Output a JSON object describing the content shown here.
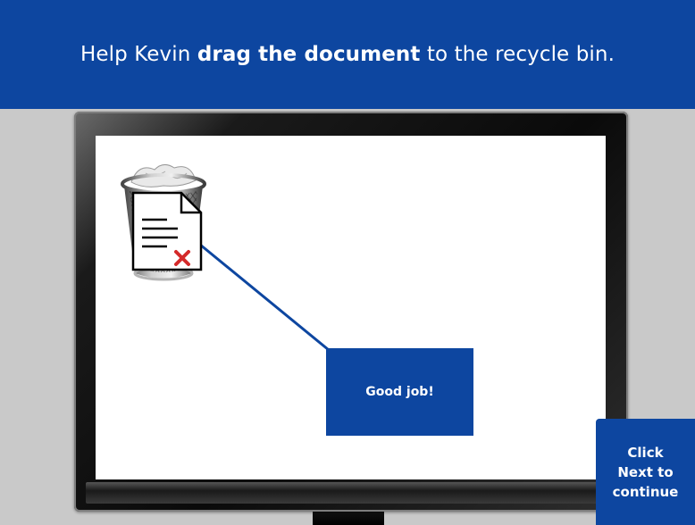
{
  "header": {
    "instruction_prefix": "Help Kevin ",
    "instruction_bold": "drag the document",
    "instruction_suffix": " to the recycle bin."
  },
  "icons": {
    "recycle_bin": "recycle-bin-icon",
    "document": "document-icon",
    "delete_mark": "red-x-icon"
  },
  "feedback": {
    "message": "Good job!"
  },
  "next_prompt": {
    "line1": "Click",
    "line2": "Next to",
    "line3": "continue"
  },
  "colors": {
    "accent_blue": "#0d46a0",
    "page_gray": "#c9c9c9",
    "delete_red": "#d42a2a"
  }
}
